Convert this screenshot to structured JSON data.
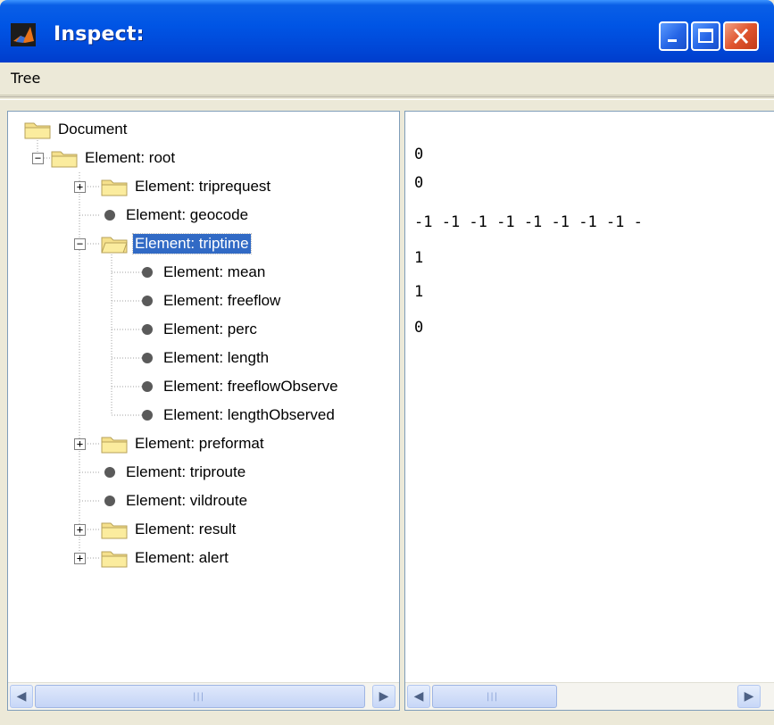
{
  "window": {
    "title": "Inspect:"
  },
  "menu": {
    "items": [
      {
        "label": "Tree"
      }
    ]
  },
  "tree": {
    "root_label": "Document",
    "nodes": [
      {
        "label": "Element: root"
      },
      {
        "label": "Element: triprequest"
      },
      {
        "label": "Element: geocode"
      },
      {
        "label": "Element: triptime",
        "selected": true
      },
      {
        "label": "Element: mean"
      },
      {
        "label": "Element: freeflow"
      },
      {
        "label": "Element: perc"
      },
      {
        "label": "Element: length"
      },
      {
        "label": "Element: freeflowObserve"
      },
      {
        "label": "Element: lengthObserved"
      },
      {
        "label": "Element: preformat"
      },
      {
        "label": "Element: triproute"
      },
      {
        "label": "Element: vildroute"
      },
      {
        "label": "Element: result"
      },
      {
        "label": "Element: alert"
      }
    ]
  },
  "values": {
    "lines": [
      "0",
      "0",
      "-1 -1 -1 -1 -1 -1 -1 -1 -",
      "1",
      "1",
      "0"
    ]
  },
  "colors": {
    "selection": "#316ac5",
    "titlebar": "#0055e5",
    "close_button": "#e0552e"
  }
}
